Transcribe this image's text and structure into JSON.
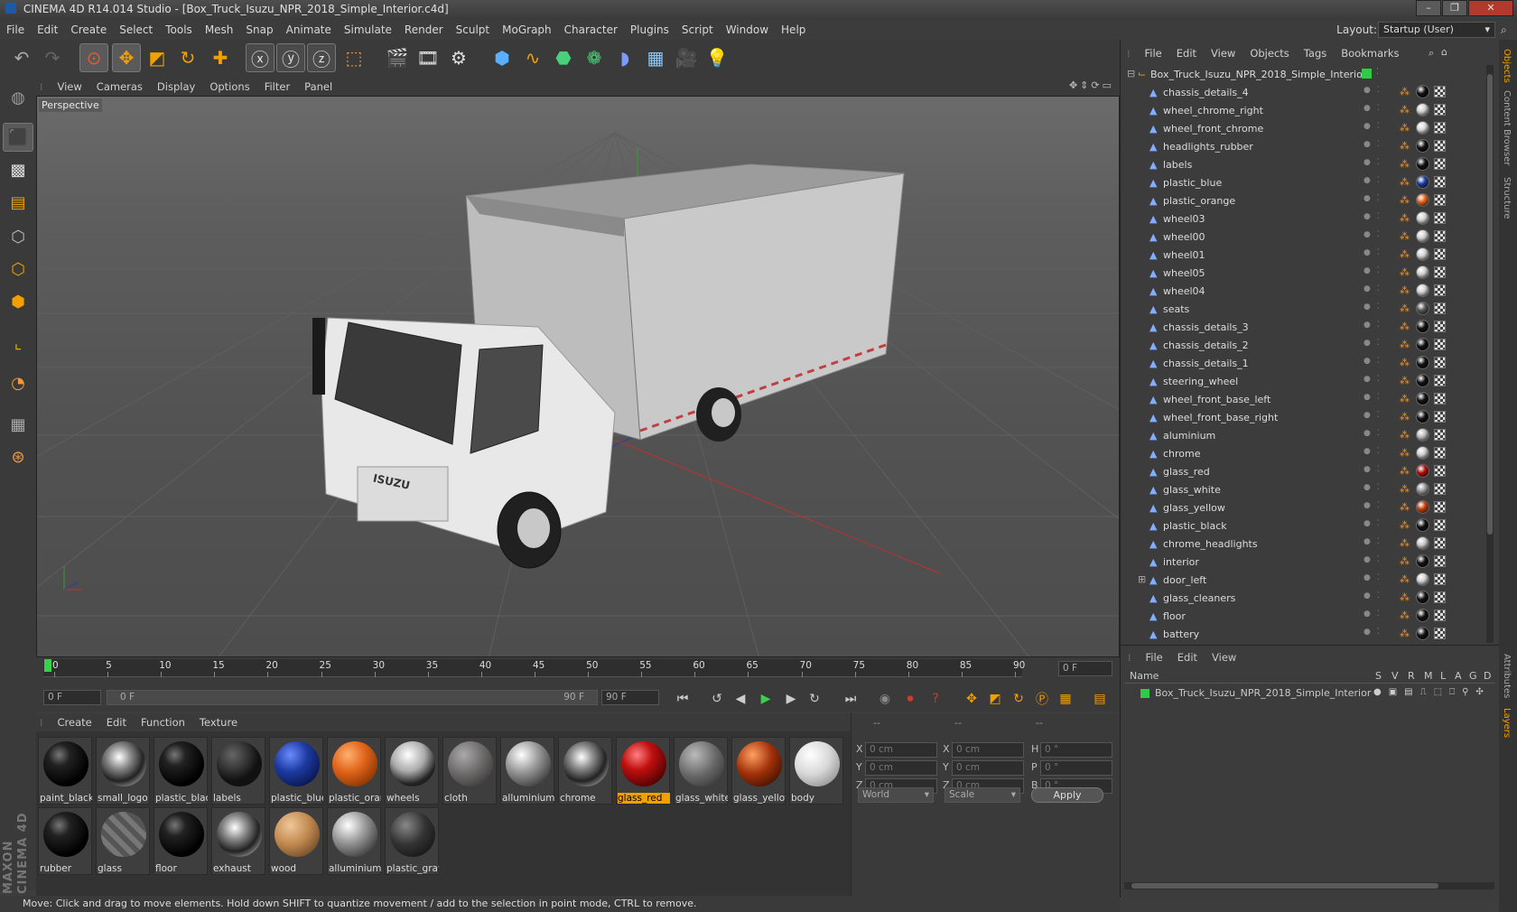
{
  "window": {
    "title": "CINEMA 4D R14.014 Studio - [Box_Truck_Isuzu_NPR_2018_Simple_Interior.c4d]",
    "layout_label": "Layout:",
    "layout_value": "Startup (User)"
  },
  "menubar": [
    "File",
    "Edit",
    "Create",
    "Select",
    "Tools",
    "Mesh",
    "Snap",
    "Animate",
    "Simulate",
    "Render",
    "Sculpt",
    "MoGraph",
    "Character",
    "Plugins",
    "Script",
    "Window",
    "Help"
  ],
  "viewport": {
    "menu": [
      "View",
      "Cameras",
      "Display",
      "Options",
      "Filter",
      "Panel"
    ],
    "label": "Perspective",
    "truck_logo": "ISUZU"
  },
  "timeline": {
    "ticks": [
      "0",
      "5",
      "10",
      "15",
      "20",
      "25",
      "30",
      "35",
      "40",
      "45",
      "50",
      "55",
      "60",
      "65",
      "70",
      "75",
      "80",
      "85",
      "90"
    ],
    "current_frame": "0 F",
    "start_field": "0 F",
    "range_start": "0 F",
    "range_end": "90 F",
    "end_field": "90 F"
  },
  "materials": {
    "menu": [
      "Create",
      "Edit",
      "Function",
      "Texture"
    ],
    "items": [
      {
        "label": "paint_black",
        "color": "black",
        "selected": false
      },
      {
        "label": "small_logo",
        "color": "chrome",
        "selected": false
      },
      {
        "label": "plastic_black",
        "color": "black",
        "selected": false
      },
      {
        "label": "labels",
        "color": "labels",
        "selected": false
      },
      {
        "label": "plastic_blue",
        "color": "blue",
        "selected": false
      },
      {
        "label": "plastic_orange",
        "color": "orange",
        "selected": false
      },
      {
        "label": "wheels",
        "color": "wheels",
        "selected": false
      },
      {
        "label": "cloth",
        "color": "grey",
        "selected": false
      },
      {
        "label": "alluminium",
        "color": "silver",
        "selected": false
      },
      {
        "label": "chrome",
        "color": "chrome",
        "selected": false
      },
      {
        "label": "glass_red",
        "color": "red",
        "selected": true
      },
      {
        "label": "glass_white",
        "color": "glass",
        "selected": false
      },
      {
        "label": "glass_yellow",
        "color": "amber",
        "selected": false
      },
      {
        "label": "body",
        "color": "white",
        "selected": false
      },
      {
        "label": "rubber",
        "color": "black",
        "selected": false
      },
      {
        "label": "glass",
        "color": "glasshatch",
        "selected": false
      },
      {
        "label": "floor",
        "color": "black",
        "selected": false
      },
      {
        "label": "exhaust",
        "color": "chrome",
        "selected": false
      },
      {
        "label": "wood",
        "color": "wood",
        "selected": false
      },
      {
        "label": "alluminium",
        "color": "silver",
        "selected": false
      },
      {
        "label": "plastic_gray",
        "color": "darkgrey",
        "selected": false
      }
    ]
  },
  "attributes": {
    "header": [
      "--",
      "--",
      "--"
    ],
    "rows": [
      {
        "a": "X",
        "av": "0 cm",
        "b": "X",
        "bv": "0 cm",
        "c": "H",
        "cv": "0 °"
      },
      {
        "a": "Y",
        "av": "0 cm",
        "b": "Y",
        "bv": "0 cm",
        "c": "P",
        "cv": "0 °"
      },
      {
        "a": "Z",
        "av": "0 cm",
        "b": "Z",
        "bv": "0 cm",
        "c": "B",
        "cv": "0 °"
      }
    ],
    "world": "World",
    "scale": "Scale",
    "apply": "Apply"
  },
  "object_manager": {
    "menu": [
      "File",
      "Edit",
      "View",
      "Objects",
      "Tags",
      "Bookmarks"
    ],
    "root": "Box_Truck_Isuzu_NPR_2018_Simple_Interior",
    "objects": [
      "chassis_details_4",
      "wheel_chrome_right",
      "wheel_front_chrome",
      "headlights_rubber",
      "labels",
      "plastic_blue",
      "plastic_orange",
      "wheel03",
      "wheel00",
      "wheel01",
      "wheel05",
      "wheel04",
      "seats",
      "chassis_details_3",
      "chassis_details_2",
      "chassis_details_1",
      "steering_wheel",
      "wheel_front_base_left",
      "wheel_front_base_right",
      "aluminium",
      "chrome",
      "glass_red",
      "glass_white",
      "glass_yellow",
      "plastic_black",
      "chrome_headlights",
      "interior",
      "door_left",
      "glass_cleaners",
      "floor",
      "battery"
    ],
    "tag_colors": [
      "#111111",
      "#cfcfcf",
      "#d8d8d8",
      "#111111",
      "#111111",
      "#1e3a9a",
      "#e0641a",
      "#d0d0d0",
      "#d0d0d0",
      "#d0d0d0",
      "#d0d0d0",
      "#d0d0d0",
      "#555555",
      "#111111",
      "#111111",
      "#111111",
      "#111111",
      "#111111",
      "#111111",
      "#bdbdbd",
      "#cfcfcf",
      "#b01010",
      "#9a9a9a",
      "#c0400c",
      "#111111",
      "#c8c8c8",
      "#111111",
      "#d0d0d0",
      "#111111",
      "#111111",
      "#111111"
    ]
  },
  "layer_manager": {
    "menu": [
      "File",
      "Edit",
      "View"
    ],
    "columns": [
      "Name",
      "S",
      "V",
      "R",
      "M",
      "L",
      "A",
      "G",
      "D"
    ],
    "row": "Box_Truck_Isuzu_NPR_2018_Simple_Interior"
  },
  "side_tabs": [
    "Objects",
    "Content Browser",
    "Structure",
    "Attributes",
    "Layers"
  ],
  "branding": "MAXON CINEMA 4D",
  "status": "Move: Click and drag to move elements. Hold down SHIFT to quantize movement / add to the selection in point mode, CTRL to remove."
}
